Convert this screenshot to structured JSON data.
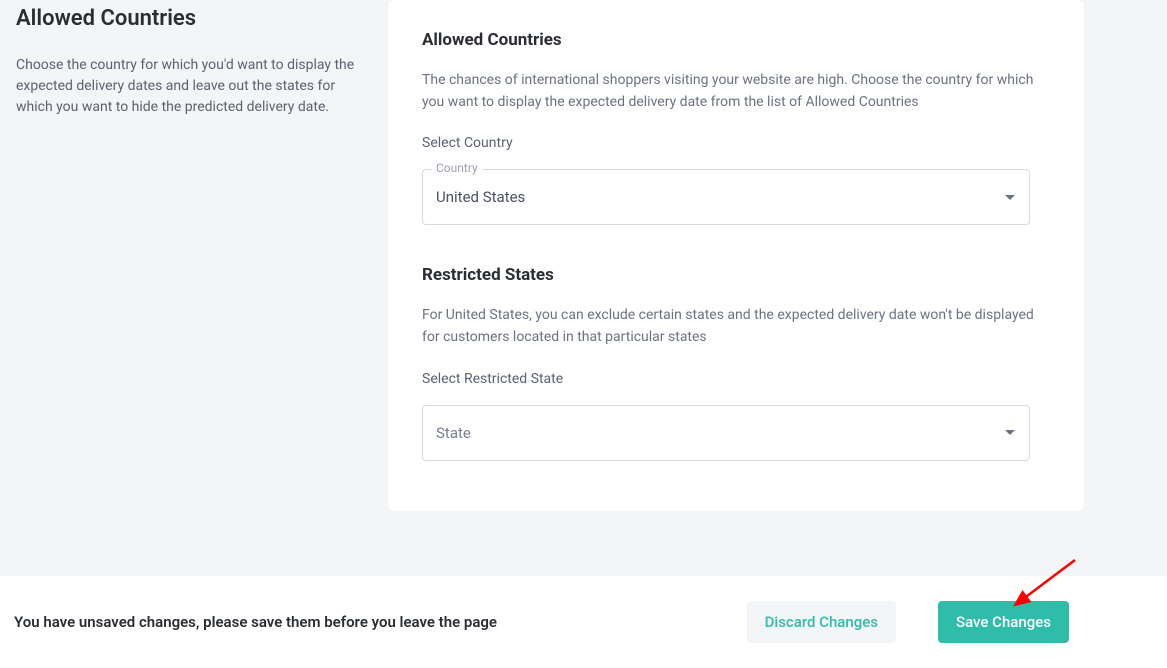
{
  "left": {
    "title": "Allowed Countries",
    "description": "Choose the country for which you'd want to display the expected delivery dates and leave out the states for which you want to hide the predicted delivery date."
  },
  "card": {
    "allowed": {
      "heading": "Allowed Countries",
      "description": "The chances of international shoppers visiting your website are high. Choose the country for which you want to display the expected delivery date from the list of Allowed Countries",
      "selectLabel": "Select Country",
      "floatingLabel": "Country",
      "value": "United States"
    },
    "restricted": {
      "heading": "Restricted States",
      "description": "For United States, you can exclude certain states and the expected delivery date won't be displayed for customers located in that particular states",
      "selectLabel": "Select Restricted State",
      "placeholder": "State"
    }
  },
  "footer": {
    "message": "You have unsaved changes, please save them before you leave the page",
    "discardLabel": "Discard Changes",
    "saveLabel": "Save Changes"
  }
}
